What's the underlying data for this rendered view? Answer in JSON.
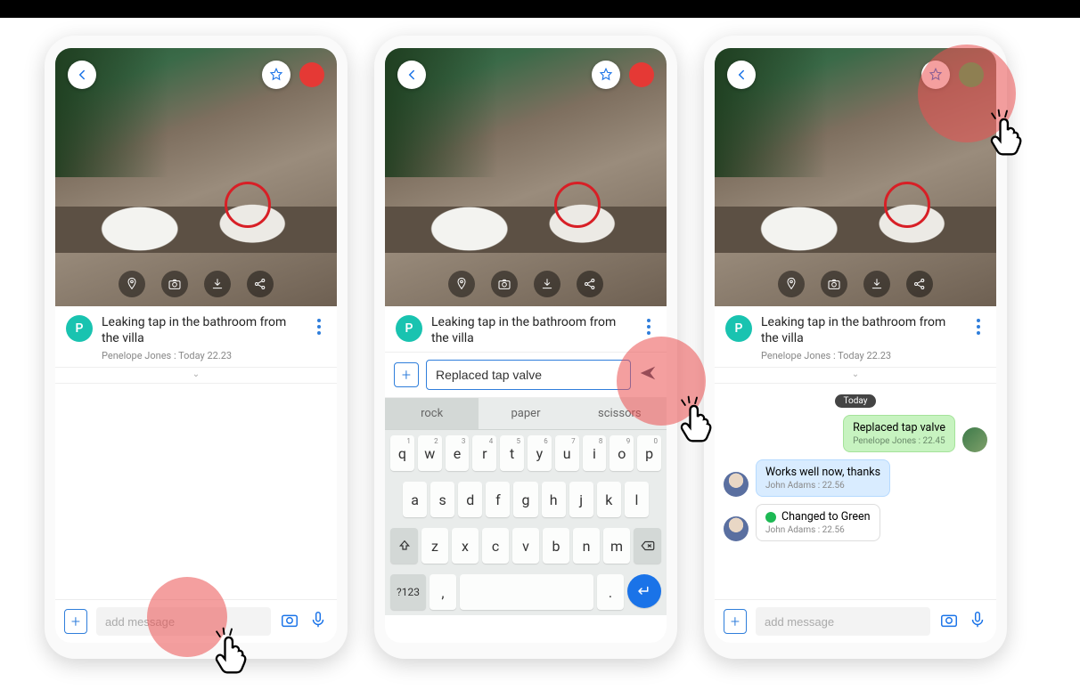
{
  "task": {
    "title": "Leaking tap in the bathroom from the villa",
    "byline": "Penelope Jones : Today 22.23",
    "avatar_initial": "P"
  },
  "input": {
    "placeholder": "add message",
    "compose_value": "Replaced tap valve"
  },
  "status": {
    "red": "#e53935",
    "green": "#1db954"
  },
  "keyboard": {
    "suggestions": [
      "rock",
      "paper",
      "scissors"
    ],
    "row1_nums": [
      "1",
      "2",
      "3",
      "4",
      "5",
      "6",
      "7",
      "8",
      "9",
      "0"
    ],
    "row1": [
      "q",
      "w",
      "e",
      "r",
      "t",
      "y",
      "u",
      "i",
      "o",
      "p"
    ],
    "row2": [
      "a",
      "s",
      "d",
      "f",
      "g",
      "h",
      "j",
      "k",
      "l"
    ],
    "row3": [
      "z",
      "x",
      "c",
      "v",
      "b",
      "n",
      "m"
    ],
    "sym_key": "?123",
    "comma": ",",
    "period": "."
  },
  "chat": {
    "day": "Today",
    "messages": [
      {
        "side": "right",
        "style": "green",
        "text": "Replaced tap valve",
        "meta": "Penelope Jones : 22.45"
      },
      {
        "side": "left",
        "style": "blue",
        "text": "Works well now, thanks",
        "meta": "John Adams : 22.56"
      },
      {
        "side": "left",
        "style": "white",
        "text": "Changed to Green",
        "meta": "John Adams : 22.56",
        "status_dot": true
      }
    ]
  }
}
